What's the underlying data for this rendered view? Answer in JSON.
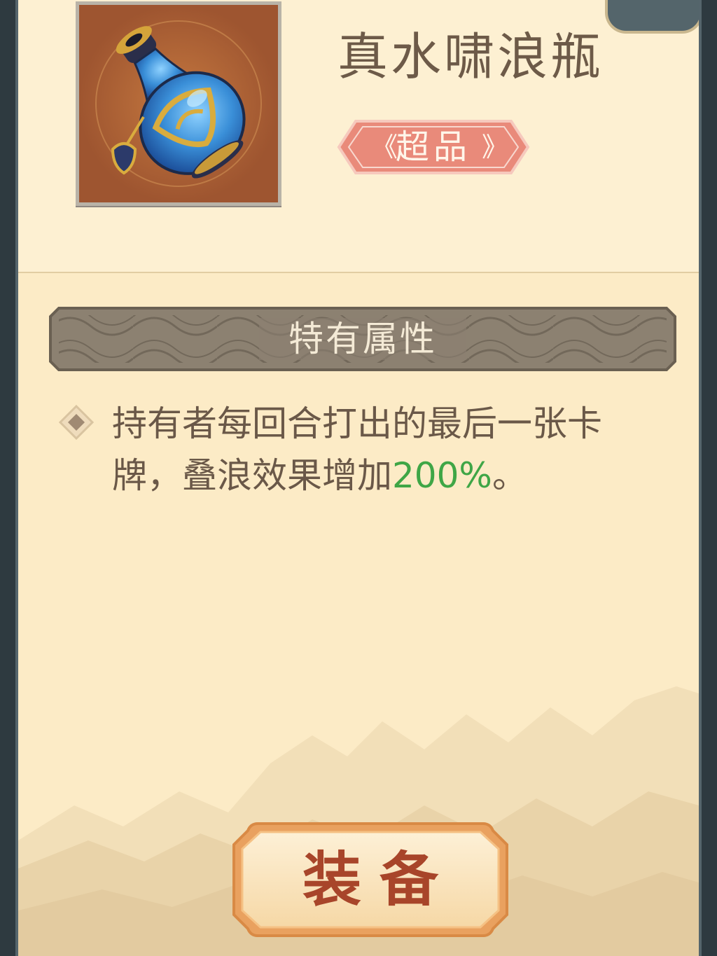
{
  "item": {
    "name": "真水啸浪瓶",
    "rarity": "超品",
    "icon": "blue-porcelain-vase-icon"
  },
  "attributes": {
    "section_title": "特有属性",
    "entries": [
      {
        "text_before": "持有者每回合打出的最后一张卡牌，叠浪效果增加",
        "highlight": "200%",
        "text_after": "。"
      }
    ]
  },
  "actions": {
    "equip_label": "装备"
  },
  "colors": {
    "panel_bg": "#fcebc6",
    "highlight_green": "#3fa646",
    "rarity_badge": "#e98a7a",
    "button_text": "#a8452a"
  }
}
